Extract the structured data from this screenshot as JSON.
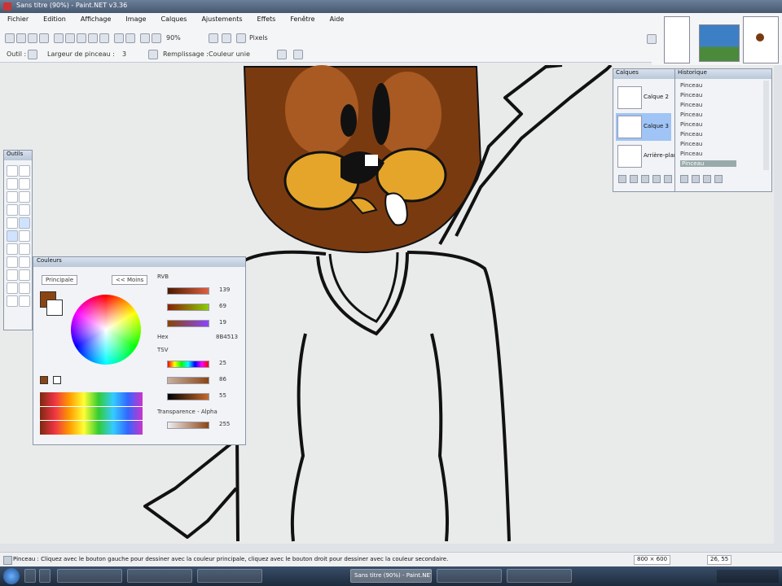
{
  "window": {
    "title": "Sans titre (90%) - Paint.NET v3.36"
  },
  "menu": [
    "Fichier",
    "Edition",
    "Affichage",
    "Image",
    "Calques",
    "Ajustements",
    "Effets",
    "Fenêtre",
    "Aide"
  ],
  "toolbar": {
    "zoom": "90%",
    "units": "Pixels",
    "size_label": "Largeur de pinceau :",
    "size_value": "3",
    "antialias_label": "Remplissage :",
    "fill_value": "Couleur unie",
    "tool_label": "Outil :"
  },
  "tools": {
    "title": "Outils"
  },
  "palette": {
    "title": "Couleurs",
    "mode": "Principale",
    "less_button": "<< Moins",
    "rgb_label": "RVB",
    "hex_label": "Hex",
    "hex_value": "8B4513",
    "tsv_label": "TSV",
    "opacity_label": "Transparence - Alpha",
    "values": [
      "139",
      "69",
      "19",
      "25",
      "86",
      "55",
      "255"
    ]
  },
  "layers": {
    "title": "Calques",
    "items": [
      "Calque 2",
      "Calque 3",
      "Arrière-plan"
    ]
  },
  "history": {
    "title": "Historique",
    "items": [
      "Pinceau",
      "Pinceau",
      "Pinceau",
      "Pinceau",
      "Pinceau",
      "Pinceau",
      "Pinceau",
      "Pinceau",
      "Pinceau"
    ]
  },
  "status": {
    "text": "Pinceau : Cliquez avec le bouton gauche pour dessiner avec la couleur principale, cliquez avec le bouton droit pour dessiner avec la couleur secondaire.",
    "size": "800 × 600",
    "coords": "26, 55"
  },
  "taskbar": {
    "items": [
      "",
      "",
      "",
      "",
      "",
      "Sans titre (90%) - Paint.NET",
      "",
      ""
    ]
  },
  "colors": {
    "fur_dark": "#7a3a10",
    "fur_light": "#a85a22",
    "cheeks": "#e4a52a",
    "outline": "#111111",
    "canvas": "#e9eaea"
  }
}
